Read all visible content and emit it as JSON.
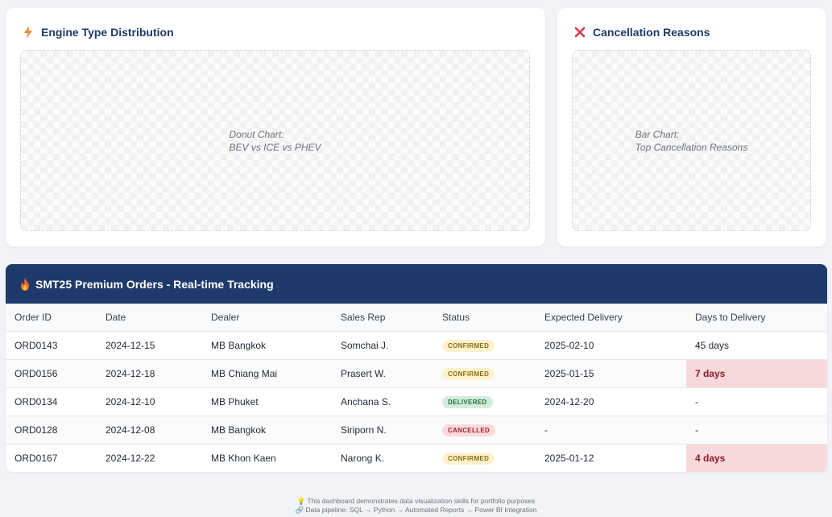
{
  "engine_card": {
    "title": "Engine Type Distribution",
    "icon": "lightning-icon",
    "placeholder_line1": "Donut Chart:",
    "placeholder_line2": "BEV vs ICE vs PHEV"
  },
  "cancel_card": {
    "title": "Cancellation Reasons",
    "icon": "x-icon",
    "placeholder_line1": "Bar Chart:",
    "placeholder_line2": "Top Cancellation Reasons"
  },
  "orders": {
    "title": "SMT25 Premium Orders - Real-time Tracking",
    "icon": "fire-icon",
    "columns": [
      "Order ID",
      "Date",
      "Dealer",
      "Sales Rep",
      "Status",
      "Expected Delivery",
      "Days to Delivery"
    ],
    "rows": [
      [
        "ORD0143",
        "2024-12-15",
        "MB Bangkok",
        "Somchai J.",
        "CONFIRMED",
        "2025-02-10",
        "45 days"
      ],
      [
        "ORD0156",
        "2024-12-18",
        "MB Chiang Mai",
        "Prasert W.",
        "CONFIRMED",
        "2025-01-15",
        "7 days"
      ],
      [
        "ORD0134",
        "2024-12-10",
        "MB Phuket",
        "Anchana S.",
        "DELIVERED",
        "2024-12-20",
        "-"
      ],
      [
        "ORD0128",
        "2024-12-08",
        "MB Bangkok",
        "Siriporn N.",
        "CANCELLED",
        "-",
        "-"
      ],
      [
        "ORD0167",
        "2024-12-22",
        "MB Khon Kaen",
        "Narong K.",
        "CONFIRMED",
        "2025-01-12",
        "4 days"
      ]
    ]
  },
  "footer": {
    "line1": "💡 This dashboard demonstrates data visualization skills for portfolio purposes",
    "line2": "🔗 Data pipeline: SQL → Python → Automated Reports → Power BI Integration"
  },
  "colors": {
    "header_bg": "#1e3a6b",
    "urgent_bg": "#f7d9dc",
    "urgent_text": "#8b1a24"
  }
}
